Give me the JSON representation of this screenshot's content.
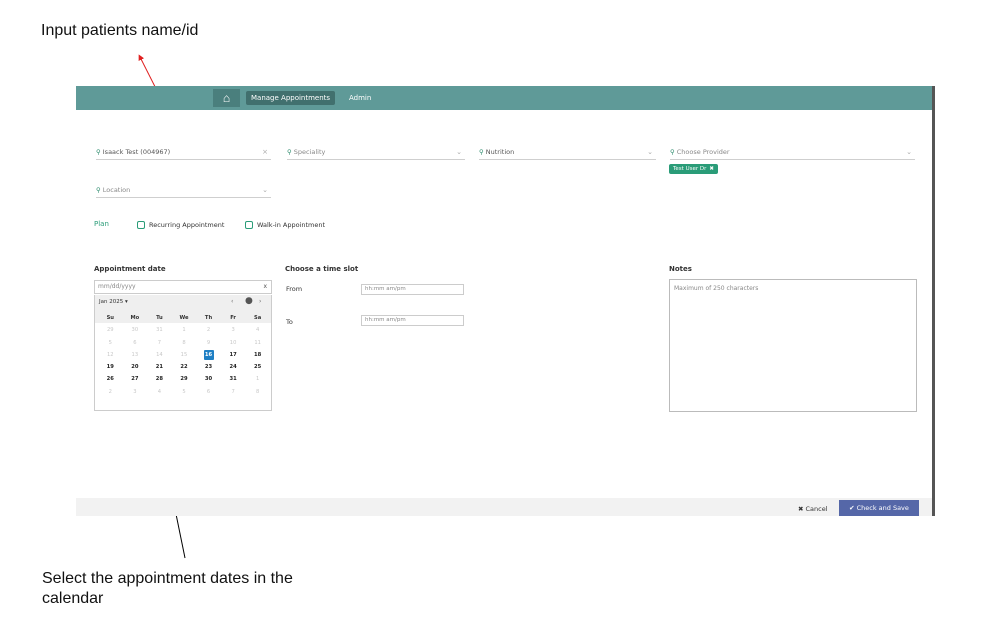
{
  "annotations": {
    "top": "Input patients name/id",
    "bottom": "Select the appointment dates in the calendar"
  },
  "nav": {
    "home_icon": "home-icon",
    "manage": "Manage Appointments",
    "admin": "Admin"
  },
  "fields": {
    "patient": {
      "value": "Isaack Test (004967)",
      "clear": "×",
      "icon": "search-icon"
    },
    "speciality": {
      "placeholder": "Speciality",
      "icon": "search-icon"
    },
    "nutrition": {
      "value": "Nutrition",
      "icon": "search-icon"
    },
    "provider": {
      "placeholder": "Choose Provider",
      "icon": "search-icon"
    },
    "location": {
      "placeholder": "Location",
      "icon": "search-icon"
    }
  },
  "provider_chip": {
    "label": "Test User Dr",
    "remove": "✖"
  },
  "plan": {
    "label": "Plan",
    "recurring": "Recurring Appointment",
    "walkin": "Walk-in Appointment"
  },
  "appointment_date": {
    "title": "Appointment date",
    "placeholder": "mm/dd/yyyy",
    "clear": "x"
  },
  "calendar": {
    "month_label": "Jan 2025 ▾",
    "prev": "‹",
    "today": "●",
    "next": "›",
    "weekdays": [
      "Su",
      "Mo",
      "Tu",
      "We",
      "Th",
      "Fr",
      "Sa"
    ],
    "weeks": [
      [
        "29",
        "30",
        "31",
        "1",
        "2",
        "3",
        "4"
      ],
      [
        "5",
        "6",
        "7",
        "8",
        "9",
        "10",
        "11"
      ],
      [
        "12",
        "13",
        "14",
        "15",
        "16",
        "17",
        "18"
      ],
      [
        "19",
        "20",
        "21",
        "22",
        "23",
        "24",
        "25"
      ],
      [
        "26",
        "27",
        "28",
        "29",
        "30",
        "31",
        "1"
      ],
      [
        "2",
        "3",
        "4",
        "5",
        "6",
        "7",
        "8"
      ]
    ],
    "selected": "16"
  },
  "time_slot": {
    "title": "Choose a time slot",
    "from_label": "From",
    "to_label": "To",
    "from_placeholder": "hh:mm am/pm",
    "to_placeholder": "hh:mm am/pm"
  },
  "notes": {
    "title": "Notes",
    "placeholder": "Maximum of 250 characters"
  },
  "footer": {
    "cancel": "✖  Cancel",
    "save": "✔  Check and Save"
  },
  "colors": {
    "topbar": "#5f9a98",
    "accent": "#2a9c78",
    "selected_day": "#1f7fc4",
    "save_button": "#5567a8"
  }
}
